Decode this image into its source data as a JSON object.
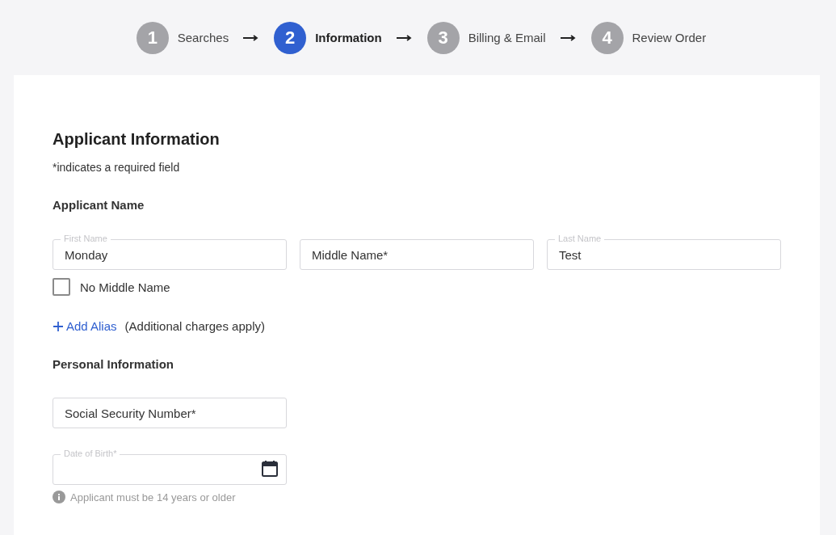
{
  "steps": [
    {
      "number": "1",
      "label": "Searches",
      "selected": false
    },
    {
      "number": "2",
      "label": "Information",
      "selected": true
    },
    {
      "number": "3",
      "label": "Billing & Email",
      "selected": false
    },
    {
      "number": "4",
      "label": "Review Order",
      "selected": false
    }
  ],
  "form": {
    "title": "Applicant Information",
    "required_note": "*indicates a required field",
    "name_section": {
      "heading": "Applicant Name",
      "fields": [
        {
          "label": "First Name",
          "value": "Monday"
        },
        {
          "placeholder": "Middle Name*"
        },
        {
          "label": "Last Name",
          "value": "Test"
        }
      ],
      "no_middle_name": {
        "label": "No Middle Name",
        "checked": false
      },
      "add_alias": {
        "link": "Add Alias",
        "note": "(Additional charges apply)"
      }
    },
    "personal_section": {
      "heading": "Personal Information",
      "ssn": {
        "placeholder": "Social Security Number*"
      },
      "dob": {
        "label": "Date of Birth*"
      },
      "dob_hint": "Applicant must be 14 years or older"
    }
  }
}
